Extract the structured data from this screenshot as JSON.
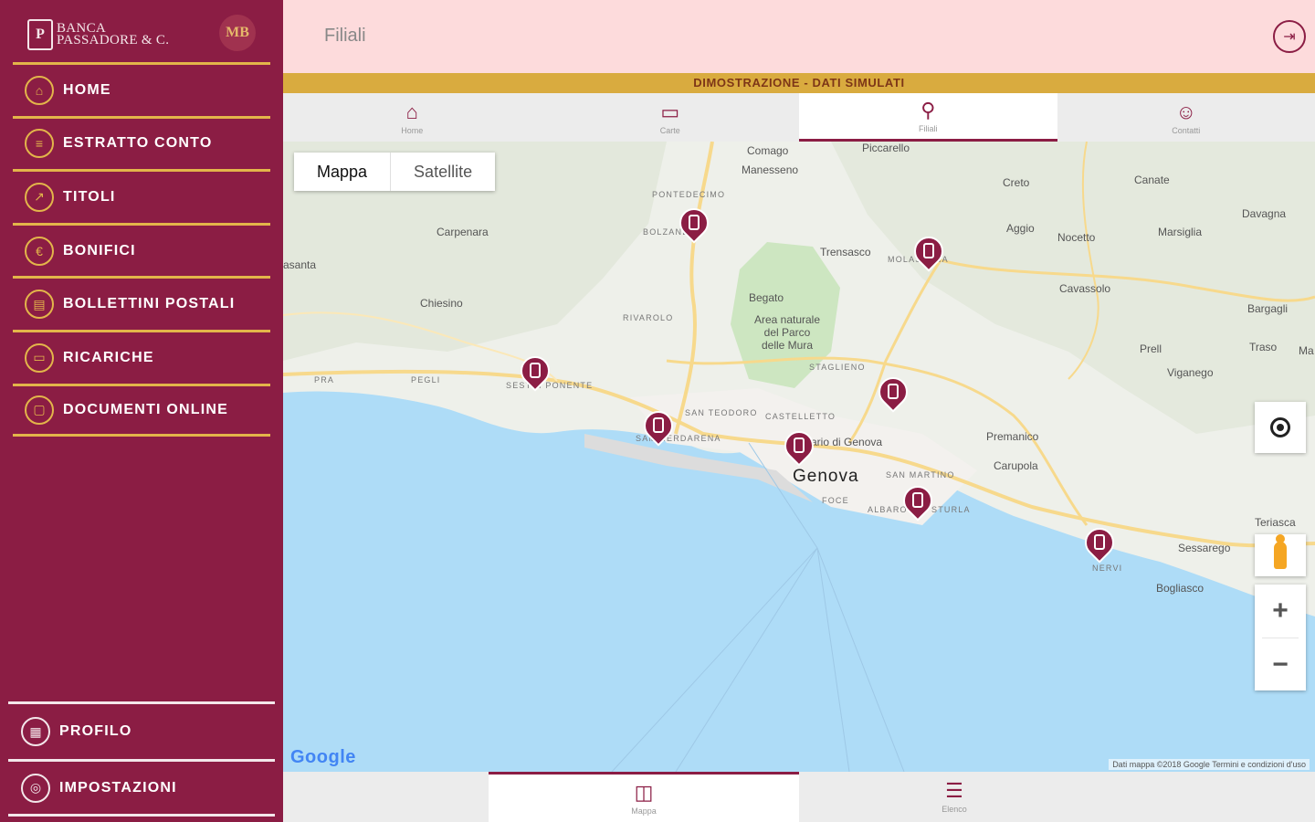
{
  "brand": {
    "logo_line1": "BANCA",
    "logo_line2": "PASSADORE & C.",
    "logo_badge": "MB"
  },
  "sidebar": {
    "items": [
      {
        "label": "HOME",
        "icon": "home-icon",
        "glyph": "⌂"
      },
      {
        "label": "ESTRATTO CONTO",
        "icon": "statement-icon",
        "glyph": "≡"
      },
      {
        "label": "TITOLI",
        "icon": "chart-icon",
        "glyph": "↗"
      },
      {
        "label": "BONIFICI",
        "icon": "transfer-icon",
        "glyph": "€"
      },
      {
        "label": "BOLLETTINI POSTALI",
        "icon": "postal-bill-icon",
        "glyph": "▤"
      },
      {
        "label": "RICARICHE",
        "icon": "topup-icon",
        "glyph": "▭"
      },
      {
        "label": "DOCUMENTI ONLINE",
        "icon": "documents-icon",
        "glyph": "▢"
      }
    ],
    "bottom_items": [
      {
        "label": "PROFILO",
        "icon": "profile-icon",
        "glyph": "▦"
      },
      {
        "label": "IMPOSTAZIONI",
        "icon": "settings-icon",
        "glyph": "◎"
      }
    ]
  },
  "header": {
    "title": "Filiali",
    "logout_icon": "logout-icon"
  },
  "demo_banner": "DIMOSTRAZIONE - DATI SIMULATI",
  "top_tabs": [
    {
      "label": "Home",
      "icon": "home-icon",
      "glyph": "⌂",
      "active": false
    },
    {
      "label": "Carte",
      "icon": "wallet-icon",
      "glyph": "▭",
      "active": false
    },
    {
      "label": "Filiali",
      "icon": "location-pin-icon",
      "glyph": "⚲",
      "active": true
    },
    {
      "label": "Contatti",
      "icon": "contact-icon",
      "glyph": "☺",
      "active": false
    }
  ],
  "map": {
    "type_buttons": [
      "Mappa",
      "Satellite"
    ],
    "selected_type": "Mappa",
    "places": {
      "comago": "Comago",
      "manesseno": "Manesseno",
      "piccarello": "Piccarello",
      "creto": "Creto",
      "canate": "Canate",
      "davagna": "Davagna",
      "pontedecimo": "PONTEDECIMO",
      "bolzaneto": "BOLZANETO",
      "carpenara": "Carpenara",
      "trensasco": "Trensasco",
      "molassana": "MOLASSANA",
      "aggio": "Aggio",
      "nocetto": "Nocetto",
      "marsiglia": "Marsiglia",
      "acquasanta": "asanta",
      "begato": "Begato",
      "area_naturale": "Area naturale\ndel Parco\ndelle Mura",
      "cavassolo": "Cavassolo",
      "bargagli": "Bargagli",
      "chiesino": "Chiesino",
      "rivarolo": "RIVAROLO",
      "staglieno": "STAGLIENO",
      "prell": "Prell",
      "viganego": "Viganego",
      "traso": "Traso",
      "pra": "PRA",
      "pegli": "PEGLI",
      "sestri_ponente": "SESTRI PONENTE",
      "san_teodoro": "SAN TEODORO",
      "castelletto": "CASTELLETTO",
      "sampierdarena": "SAMPIERDARENA",
      "acquario": "ario di Genova",
      "genova": "Genova",
      "san_martino": "SAN MARTINO",
      "foce": "FOCE",
      "albaro": "ALBARO",
      "sturla": "STURLA",
      "premanico": "Premanico",
      "canepa": "Carupola",
      "nervi": "NERVI",
      "terrasca": "Teriasca",
      "sessarego": "Sessarego",
      "bogliasco": "Bogliasco",
      "ma": "Ma"
    },
    "google": "Google",
    "attribution": "Dati mappa ©2018 Google    Termini e condizioni d'uso"
  },
  "bottom_tabs": [
    {
      "label": "Mappa",
      "icon": "map-icon",
      "glyph": "◫",
      "active": true
    },
    {
      "label": "Elenco",
      "icon": "list-icon",
      "glyph": "☰",
      "active": false
    }
  ],
  "colors": {
    "brand": "#8b1d44",
    "accent": "#e3b54a",
    "header_bg": "#fddbdc",
    "demo_bar": "#d9ab3f"
  }
}
